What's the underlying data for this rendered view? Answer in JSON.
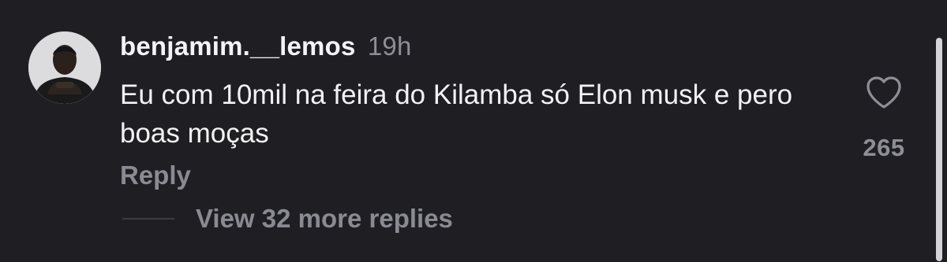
{
  "comment": {
    "username": "benjamim.__lemos",
    "timestamp": "19h",
    "text": "Eu com 10mil na feira do Kilamba só Elon musk e pero boas moças",
    "reply_label": "Reply",
    "like_count": "265",
    "view_replies_label": "View 32 more replies"
  },
  "icons": {
    "like": "heart-outline-icon",
    "avatar": "profile-photo"
  },
  "colors": {
    "background": "#1f1f23",
    "primary_text": "#f2f2f4",
    "secondary_text": "#8a8a92",
    "scrollbar": "#d4d4d8"
  }
}
